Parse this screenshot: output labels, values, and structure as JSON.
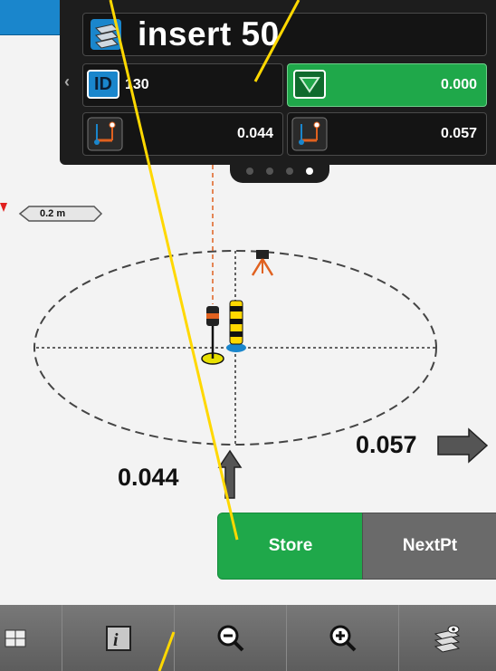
{
  "header": {
    "title": "insert 50",
    "icon": "layers-icon"
  },
  "fields": {
    "id_label": "ID",
    "id_value": "130",
    "elevation_value": "0.000",
    "offset_left_value": "0.044",
    "offset_right_value": "0.057"
  },
  "pager": {
    "count": 4,
    "active_index": 3
  },
  "scale_label": "0.2 m",
  "plot": {
    "value_cross": "0.044",
    "value_along": "0.057"
  },
  "actions": {
    "store_label": "Store",
    "nextpt_label": "NextPt"
  },
  "toolbar": {
    "items": [
      "grid-icon",
      "info-icon",
      "zoom-out-icon",
      "zoom-in-icon",
      "layers-view-icon"
    ]
  },
  "colors": {
    "accent_green": "#1fa84a",
    "header_blue": "#1a86cc",
    "annotation_yellow": "#ffd800"
  }
}
